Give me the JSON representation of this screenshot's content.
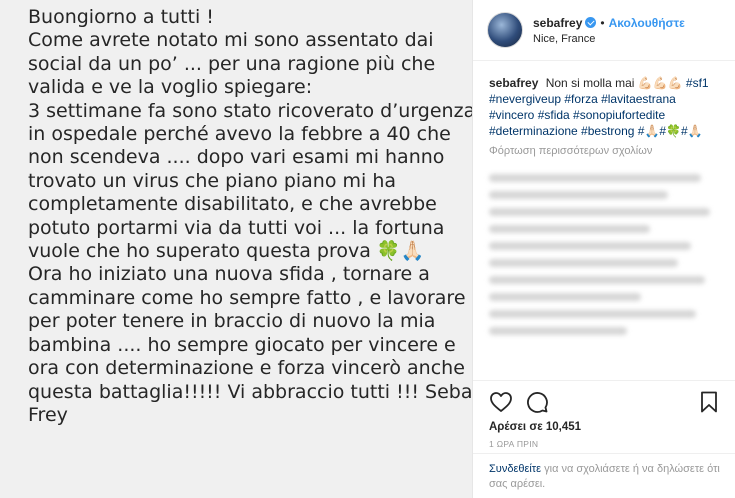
{
  "post_text_lines": [
    "Buongiorno a tutti !",
    "Come avrete notato mi sono assentato dai",
    "social da un po’ ... per una ragione più che",
    "valida e ve la voglio spiegare:",
    "3 settimane fa sono stato ricoverato d’urgenza",
    "in ospedale perché avevo la febbre a 40 che",
    "non scendeva .... dopo vari esami mi hanno",
    "trovato un virus che piano piano mi ha",
    "completamente disabilitato, e che avrebbe",
    "potuto portarmi via da tutti voi ... la fortuna",
    "vuole che ho superato questa prova 🍀🙏🏻",
    "Ora ho iniziato una nuova sfida , tornare a",
    "camminare come ho sempre fatto , e lavorare",
    "per poter tenere in braccio di nuovo la mia",
    "bambina .... ho sempre giocato per vincere e",
    "ora con determinazione e forza vincerò anche",
    "questa battaglia!!!!! Vi abbraccio tutti !!! Seba",
    "Frey"
  ],
  "header": {
    "username": "sebafrey",
    "dot": "•",
    "follow_label": "Ακολουθήστε",
    "location": "Nice, France"
  },
  "caption": {
    "username": "sebafrey",
    "text": "Non si molla mai 💪🏻💪🏻💪🏻",
    "hashtags": "#sf1 #nevergiveup #forza #lavitaestrana #vincero #sfida #sonopiufortedite #determinazione #bestrong #🙏🏻#🍀#🙏🏻"
  },
  "load_more": "Φόρτωση περισσότερων σχολίων",
  "likes": "Αρέσει σε 10,451",
  "time": "1 ΩΡΑ ΠΡΙΝ",
  "login": {
    "link": "Συνδεθείτε",
    "text": " για να σχολιάσετε ή να δηλώσετε ότι σας αρέσει."
  },
  "icons": {
    "like": "heart-icon",
    "comment": "comment-icon",
    "share": "share-icon",
    "save": "bookmark-icon",
    "verified": "verified-badge-icon"
  },
  "colors": {
    "accent": "#3897f0",
    "hashtag": "#003569",
    "muted": "#999999",
    "photo_bg": "#f0f0f0"
  }
}
